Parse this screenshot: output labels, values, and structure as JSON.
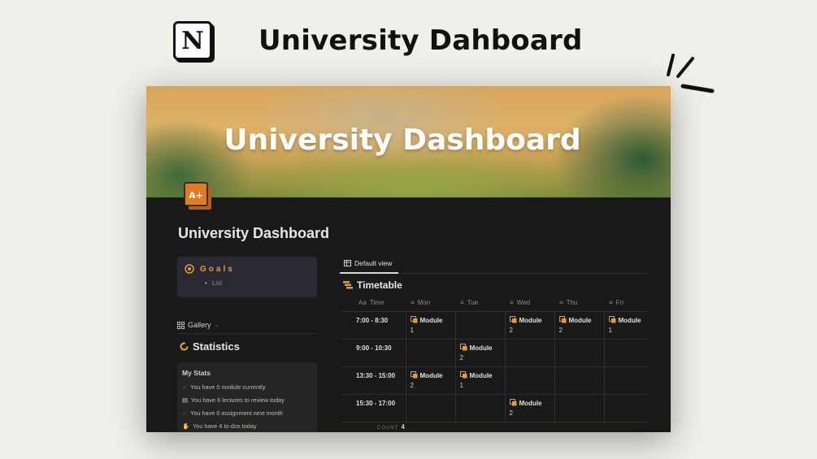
{
  "header": {
    "logo_letter": "N",
    "title": "University Dahboard"
  },
  "cover": {
    "title": "University Dashboard"
  },
  "page": {
    "icon_text": "A+",
    "title": "University Dashboard"
  },
  "goals": {
    "title": "Goals",
    "items": [
      "List"
    ]
  },
  "gallery": {
    "label": "Gallery"
  },
  "stats": {
    "heading": "Statistics",
    "card_title": "My Stats",
    "rows": [
      "You have 0 module currently",
      "You have 6 lectures to review today",
      "You have 0 assignment next month",
      "You have 4 to-dos today"
    ]
  },
  "timetable": {
    "view_label": "Default view",
    "heading": "Timetable",
    "time_col_prefix": "Aa",
    "columns": [
      "Time",
      "Mon",
      "Tue",
      "Wed",
      "Thu",
      "Fri"
    ],
    "rows": [
      {
        "time": "7:00 - 8:30",
        "cells": [
          "1",
          "",
          "2",
          "2",
          "1"
        ]
      },
      {
        "time": "9:00 - 10:30",
        "cells": [
          "",
          "2",
          "",
          "",
          ""
        ]
      },
      {
        "time": "13:30 - 15:00",
        "cells": [
          "2",
          "1",
          "",
          "",
          ""
        ]
      },
      {
        "time": "15:30 - 17:00",
        "cells": [
          "",
          "",
          "2",
          "",
          ""
        ]
      }
    ],
    "module_label": "Module",
    "count_label": "COUNT",
    "count_value": "4"
  },
  "colors": {
    "accent": "#e39a3a",
    "background": "#191919",
    "page": "#f1efea"
  }
}
